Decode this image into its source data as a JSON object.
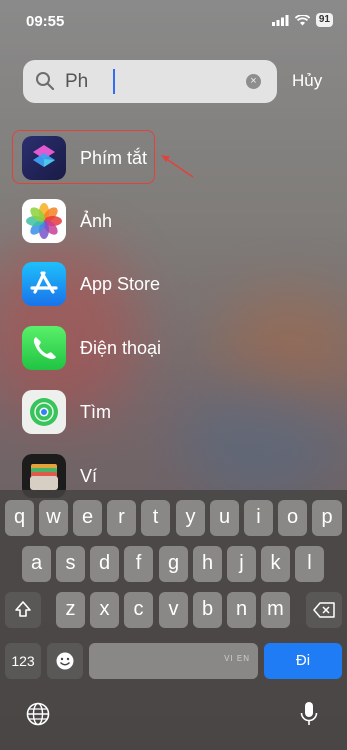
{
  "status": {
    "time": "09:55",
    "battery": "91"
  },
  "search": {
    "query": "Ph",
    "cancel_label": "Hủy"
  },
  "results": [
    {
      "label": "Phím tắt",
      "icon": "shortcuts-icon"
    },
    {
      "label": "Ảnh",
      "icon": "photos-icon"
    },
    {
      "label": "App Store",
      "icon": "app-store-icon"
    },
    {
      "label": "Điện thoại",
      "icon": "phone-icon"
    },
    {
      "label": "Tìm",
      "icon": "find-my-icon"
    },
    {
      "label": "Ví",
      "icon": "wallet-icon"
    }
  ],
  "keyboard": {
    "row1": [
      "q",
      "w",
      "e",
      "r",
      "t",
      "y",
      "u",
      "i",
      "o",
      "p"
    ],
    "row2": [
      "a",
      "s",
      "d",
      "f",
      "g",
      "h",
      "j",
      "k",
      "l"
    ],
    "row3": [
      "z",
      "x",
      "c",
      "v",
      "b",
      "n",
      "m"
    ],
    "numbers_label": "123",
    "go_label": "Đi",
    "space_language": "VI EN"
  }
}
